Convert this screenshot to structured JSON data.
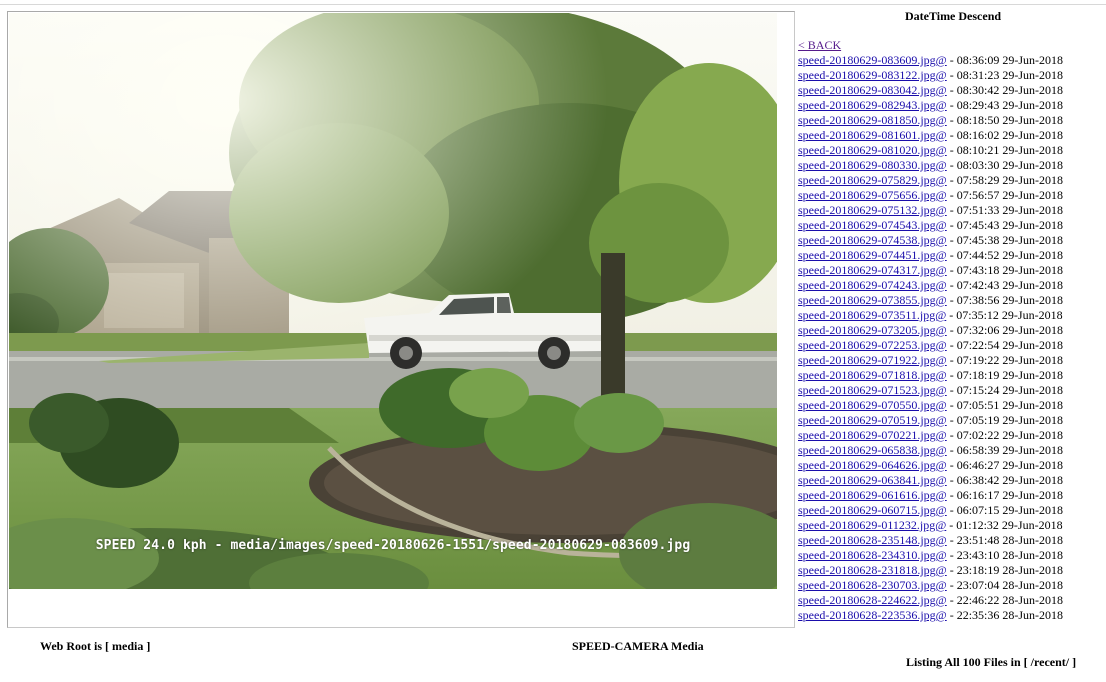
{
  "image": {
    "caption": "SPEED 24.0 kph - media/images/speed-20180626-1551/speed-20180629-083609.jpg"
  },
  "sidebar": {
    "heading": "DateTime Descend",
    "back_label": "< BACK",
    "files": [
      {
        "name": "speed-20180629-083609.jpg@",
        "time": " - 08:36:09 29-Jun-2018"
      },
      {
        "name": "speed-20180629-083122.jpg@",
        "time": " - 08:31:23 29-Jun-2018"
      },
      {
        "name": "speed-20180629-083042.jpg@",
        "time": " - 08:30:42 29-Jun-2018"
      },
      {
        "name": "speed-20180629-082943.jpg@",
        "time": " - 08:29:43 29-Jun-2018"
      },
      {
        "name": "speed-20180629-081850.jpg@",
        "time": " - 08:18:50 29-Jun-2018"
      },
      {
        "name": "speed-20180629-081601.jpg@",
        "time": " - 08:16:02 29-Jun-2018"
      },
      {
        "name": "speed-20180629-081020.jpg@",
        "time": " - 08:10:21 29-Jun-2018"
      },
      {
        "name": "speed-20180629-080330.jpg@",
        "time": " - 08:03:30 29-Jun-2018"
      },
      {
        "name": "speed-20180629-075829.jpg@",
        "time": " - 07:58:29 29-Jun-2018"
      },
      {
        "name": "speed-20180629-075656.jpg@",
        "time": " - 07:56:57 29-Jun-2018"
      },
      {
        "name": "speed-20180629-075132.jpg@",
        "time": " - 07:51:33 29-Jun-2018"
      },
      {
        "name": "speed-20180629-074543.jpg@",
        "time": " - 07:45:43 29-Jun-2018"
      },
      {
        "name": "speed-20180629-074538.jpg@",
        "time": " - 07:45:38 29-Jun-2018"
      },
      {
        "name": "speed-20180629-074451.jpg@",
        "time": " - 07:44:52 29-Jun-2018"
      },
      {
        "name": "speed-20180629-074317.jpg@",
        "time": " - 07:43:18 29-Jun-2018"
      },
      {
        "name": "speed-20180629-074243.jpg@",
        "time": " - 07:42:43 29-Jun-2018"
      },
      {
        "name": "speed-20180629-073855.jpg@",
        "time": " - 07:38:56 29-Jun-2018"
      },
      {
        "name": "speed-20180629-073511.jpg@",
        "time": " - 07:35:12 29-Jun-2018"
      },
      {
        "name": "speed-20180629-073205.jpg@",
        "time": " - 07:32:06 29-Jun-2018"
      },
      {
        "name": "speed-20180629-072253.jpg@",
        "time": " - 07:22:54 29-Jun-2018"
      },
      {
        "name": "speed-20180629-071922.jpg@",
        "time": " - 07:19:22 29-Jun-2018"
      },
      {
        "name": "speed-20180629-071818.jpg@",
        "time": " - 07:18:19 29-Jun-2018"
      },
      {
        "name": "speed-20180629-071523.jpg@",
        "time": " - 07:15:24 29-Jun-2018"
      },
      {
        "name": "speed-20180629-070550.jpg@",
        "time": " - 07:05:51 29-Jun-2018"
      },
      {
        "name": "speed-20180629-070519.jpg@",
        "time": " - 07:05:19 29-Jun-2018"
      },
      {
        "name": "speed-20180629-070221.jpg@",
        "time": " - 07:02:22 29-Jun-2018"
      },
      {
        "name": "speed-20180629-065838.jpg@",
        "time": " - 06:58:39 29-Jun-2018"
      },
      {
        "name": "speed-20180629-064626.jpg@",
        "time": " - 06:46:27 29-Jun-2018"
      },
      {
        "name": "speed-20180629-063841.jpg@",
        "time": " - 06:38:42 29-Jun-2018"
      },
      {
        "name": "speed-20180629-061616.jpg@",
        "time": " - 06:16:17 29-Jun-2018"
      },
      {
        "name": "speed-20180629-060715.jpg@",
        "time": " - 06:07:15 29-Jun-2018"
      },
      {
        "name": "speed-20180629-011232.jpg@",
        "time": " - 01:12:32 29-Jun-2018"
      },
      {
        "name": "speed-20180628-235148.jpg@",
        "time": " - 23:51:48 28-Jun-2018"
      },
      {
        "name": "speed-20180628-234310.jpg@",
        "time": " - 23:43:10 28-Jun-2018"
      },
      {
        "name": "speed-20180628-231818.jpg@",
        "time": " - 23:18:19 28-Jun-2018"
      },
      {
        "name": "speed-20180628-230703.jpg@",
        "time": " - 23:07:04 28-Jun-2018"
      },
      {
        "name": "speed-20180628-224622.jpg@",
        "time": " - 22:46:22 28-Jun-2018"
      },
      {
        "name": "speed-20180628-223536.jpg@",
        "time": " - 22:35:36 28-Jun-2018"
      }
    ]
  },
  "footer": {
    "web_root": "Web Root is [ media ]",
    "title": "SPEED-CAMERA Media",
    "listing": "Listing All 100 Files in [ /recent/ ]"
  }
}
